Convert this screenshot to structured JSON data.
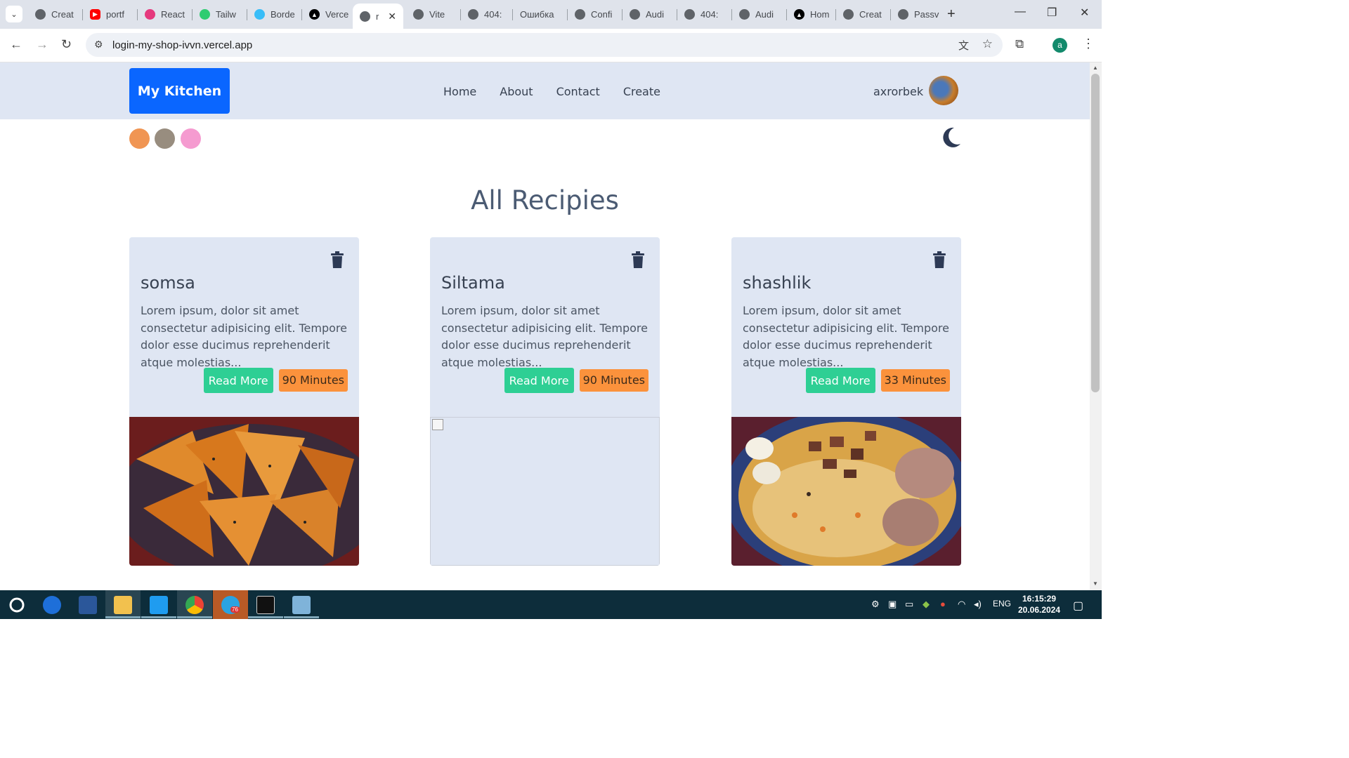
{
  "browser": {
    "tabs": [
      {
        "title": "Creat",
        "favicon": "globe-icon",
        "color": "#5f6368"
      },
      {
        "title": "portf",
        "favicon": "youtube-icon",
        "color": "#ff0000"
      },
      {
        "title": "React",
        "favicon": "react-icon",
        "color": "#e5397d"
      },
      {
        "title": "Tailw",
        "favicon": "figure-icon",
        "color": "#2ecc71"
      },
      {
        "title": "Borde",
        "favicon": "tailwind-icon",
        "color": "#38bdf8"
      },
      {
        "title": "Verce",
        "favicon": "vercel-icon",
        "color": "#000000"
      },
      {
        "title": "r",
        "favicon": "globe-icon",
        "color": "#5f6368",
        "active": true
      },
      {
        "title": "Vite",
        "favicon": "globe-icon",
        "color": "#5f6368"
      },
      {
        "title": "404:",
        "favicon": "globe-icon",
        "color": "#5f6368"
      },
      {
        "title": "Ошибка",
        "favicon": "none",
        "color": "#5f6368"
      },
      {
        "title": "Confi",
        "favicon": "globe-icon",
        "color": "#5f6368"
      },
      {
        "title": "Audi",
        "favicon": "globe-icon",
        "color": "#5f6368"
      },
      {
        "title": "404:",
        "favicon": "globe-icon",
        "color": "#5f6368"
      },
      {
        "title": "Audi",
        "favicon": "globe-icon",
        "color": "#5f6368"
      },
      {
        "title": "Hom",
        "favicon": "vercel-icon",
        "color": "#000000"
      },
      {
        "title": "Creat",
        "favicon": "globe-icon",
        "color": "#5f6368"
      },
      {
        "title": "Passv",
        "favicon": "globe-icon",
        "color": "#5f6368"
      }
    ],
    "url": "login-my-shop-ivvn.vercel.app",
    "profile_initial": "a"
  },
  "navbar": {
    "brand": "My Kitchen",
    "links": [
      "Home",
      "About",
      "Contact",
      "Create"
    ],
    "username": "axrorbek"
  },
  "theme_colors": [
    "#f09553",
    "#988d7f",
    "#f59bd0"
  ],
  "page": {
    "heading": "All Recipies"
  },
  "recipes": [
    {
      "title": "somsa",
      "description": "Lorem ipsum, dolor sit amet consectetur adipisicing elit. Tempore dolor esse ducimus reprehenderit atque molestias...",
      "read_more": "Read More",
      "time": "90 Minutes",
      "image": "somsa-photo"
    },
    {
      "title": "Siltama",
      "description": "Lorem ipsum, dolor sit amet consectetur adipisicing elit. Tempore dolor esse ducimus reprehenderit atque molestias...",
      "read_more": "Read More",
      "time": "90 Minutes",
      "image": "broken-image"
    },
    {
      "title": "shashlik",
      "description": "Lorem ipsum, dolor sit amet consectetur adipisicing elit. Tempore dolor esse ducimus reprehenderit atque molestias...",
      "read_more": "Read More",
      "time": "33 Minutes",
      "image": "plov-photo"
    }
  ],
  "taskbar": {
    "language": "ENG",
    "time": "16:15:29",
    "date": "20.06.2024",
    "telegram_badge": "76"
  }
}
